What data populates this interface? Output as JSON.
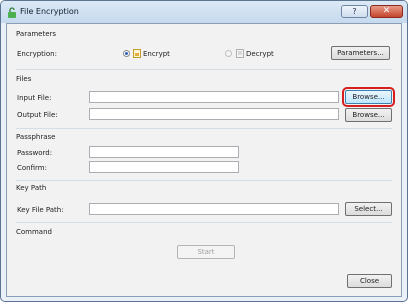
{
  "window": {
    "title": "File Encryption",
    "help_label": "?",
    "close_glyph": "✕"
  },
  "parameters": {
    "group_title": "Parameters",
    "encryption_label": "Encryption:",
    "encrypt_label": "Encrypt",
    "decrypt_label": "Decrypt",
    "selected": "Encrypt",
    "parameters_button": "Parameters..."
  },
  "files": {
    "group_title": "Files",
    "input_label": "Input File:",
    "input_value": "",
    "input_browse": "Browse...",
    "output_label": "Output File:",
    "output_value": "",
    "output_browse": "Browse..."
  },
  "passphrase": {
    "group_title": "Passphrase",
    "password_label": "Password:",
    "password_value": "",
    "confirm_label": "Confirm:",
    "confirm_value": ""
  },
  "key_path": {
    "group_title": "Key Path",
    "key_file_label": "Key File Path:",
    "key_file_value": "",
    "select_button": "Select..."
  },
  "command": {
    "group_title": "Command",
    "start_button": "Start"
  },
  "footer": {
    "close_button": "Close"
  },
  "colors": {
    "highlight": "#d6201e",
    "radio_selected": "#2a63b8"
  }
}
